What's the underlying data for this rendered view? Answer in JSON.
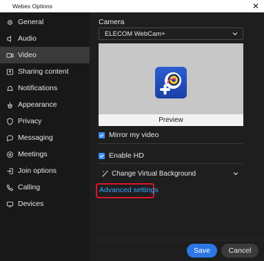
{
  "window": {
    "title": "Webex Options",
    "close_glyph": "✕"
  },
  "sidebar": {
    "items": [
      {
        "label": "General",
        "icon": "gear-icon"
      },
      {
        "label": "Audio",
        "icon": "speaker-icon"
      },
      {
        "label": "Video",
        "icon": "video-icon",
        "active": true
      },
      {
        "label": "Sharing content",
        "icon": "share-icon"
      },
      {
        "label": "Notifications",
        "icon": "bell-icon"
      },
      {
        "label": "Appearance",
        "icon": "brush-icon"
      },
      {
        "label": "Privacy",
        "icon": "shield-icon"
      },
      {
        "label": "Messaging",
        "icon": "chat-icon"
      },
      {
        "label": "Meetings",
        "icon": "meetings-icon"
      },
      {
        "label": "Join options",
        "icon": "join-icon"
      },
      {
        "label": "Calling",
        "icon": "phone-icon"
      },
      {
        "label": "Devices",
        "icon": "devices-icon"
      }
    ]
  },
  "video": {
    "section_title": "Camera",
    "camera_selected": "ELECOM WebCam+",
    "preview_label": "Preview",
    "mirror_label": "Mirror my video",
    "mirror_checked": true,
    "hd_label": "Enable HD",
    "hd_checked": true,
    "virtual_bg_label": "Change Virtual Background",
    "advanced_label": "Advanced settings"
  },
  "footer": {
    "save_label": "Save",
    "cancel_label": "Cancel"
  },
  "colors": {
    "accent": "#2b77e6",
    "link": "#35a8ff",
    "highlight": "#e0142b"
  }
}
